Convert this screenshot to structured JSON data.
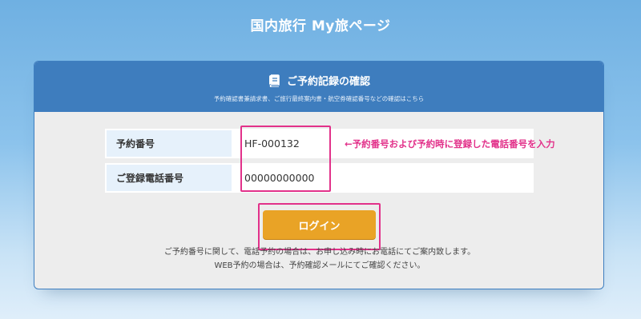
{
  "page_title": "国内旅行 My旅ページ",
  "card": {
    "title": "ご予約記録の確認",
    "subtitle": "予約確認書兼請求書、ご旅行最終案内書・航空券確認番号などの確認はこちら",
    "icon": "book-icon"
  },
  "form": {
    "reservation_number_label": "予約番号",
    "reservation_number_value": "HF-000132",
    "phone_label": "ご登録電話番号",
    "phone_value": "00000000000"
  },
  "annotation": "←予約番号および予約時に登録した電話番号を入力",
  "login_button": "ログイン",
  "notes": {
    "line1": "ご予約番号に関して、電話予約の場合は、お申し込み時にお電話にてご案内致します。",
    "line2": "WEB予約の場合は、予約確認メールにてご確認ください。"
  },
  "colors": {
    "header_blue": "#3e7dbe",
    "highlight_pink": "#e2318a",
    "button_orange": "#e9a326"
  }
}
